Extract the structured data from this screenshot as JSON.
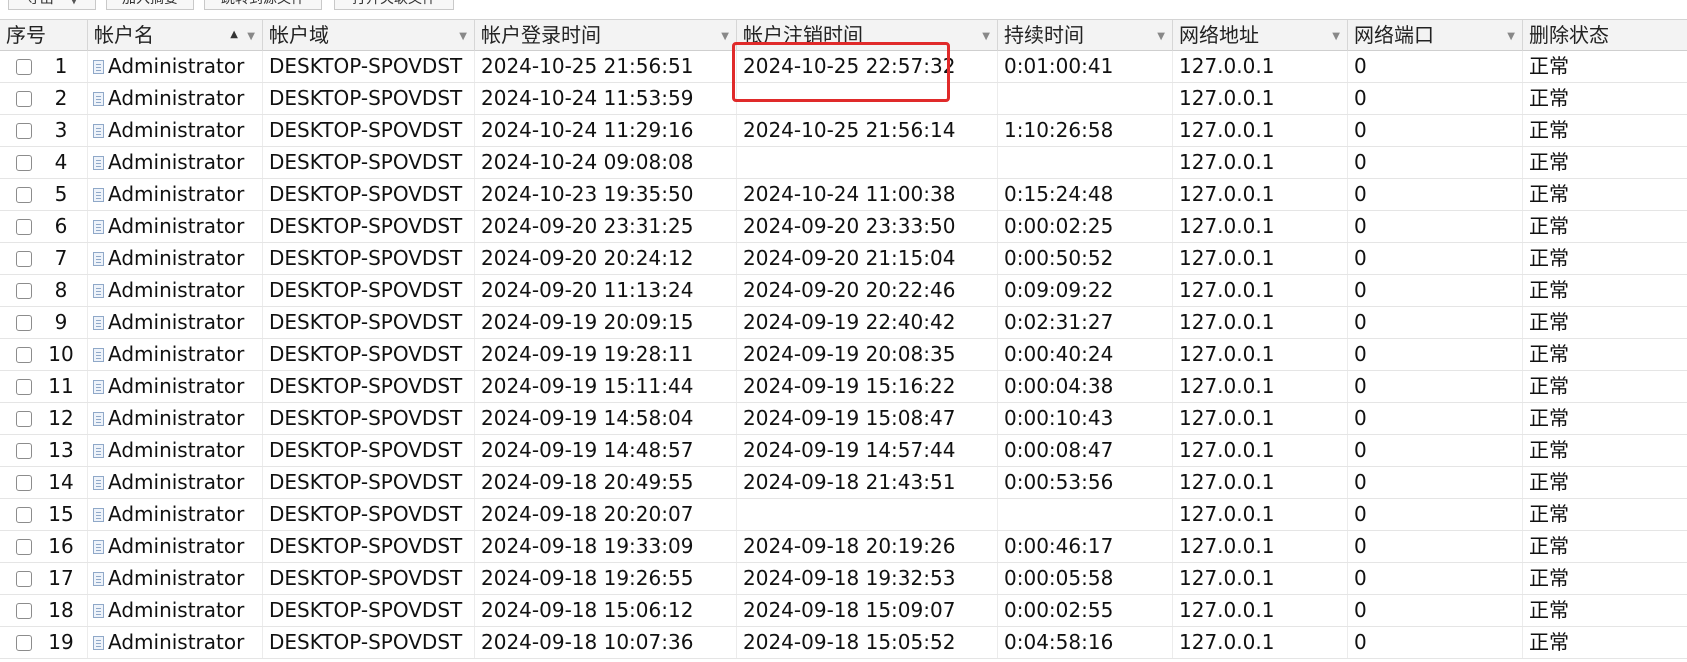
{
  "toolbar": {
    "buttons": [
      "导出",
      "加入摘要",
      "跳转到源文件",
      "打开关联文件"
    ]
  },
  "table": {
    "columns": [
      "序号",
      "帐户名",
      "帐户域",
      "帐户登录时间",
      "帐户注销时间",
      "持续时间",
      "网络地址",
      "网络端口",
      "删除状态"
    ],
    "rows": [
      {
        "seq": "1",
        "user": "Administrator",
        "domain": "DESKTOP-SPOVDST",
        "login": "2024-10-25 21:56:51",
        "logout": "2024-10-25 22:57:32",
        "duration": "0:01:00:41",
        "addr": "127.0.0.1",
        "port": "0",
        "status": "正常"
      },
      {
        "seq": "2",
        "user": "Administrator",
        "domain": "DESKTOP-SPOVDST",
        "login": "2024-10-24 11:53:59",
        "logout": "",
        "duration": "",
        "addr": "127.0.0.1",
        "port": "0",
        "status": "正常"
      },
      {
        "seq": "3",
        "user": "Administrator",
        "domain": "DESKTOP-SPOVDST",
        "login": "2024-10-24 11:29:16",
        "logout": "2024-10-25 21:56:14",
        "duration": "1:10:26:58",
        "addr": "127.0.0.1",
        "port": "0",
        "status": "正常"
      },
      {
        "seq": "4",
        "user": "Administrator",
        "domain": "DESKTOP-SPOVDST",
        "login": "2024-10-24 09:08:08",
        "logout": "",
        "duration": "",
        "addr": "127.0.0.1",
        "port": "0",
        "status": "正常"
      },
      {
        "seq": "5",
        "user": "Administrator",
        "domain": "DESKTOP-SPOVDST",
        "login": "2024-10-23 19:35:50",
        "logout": "2024-10-24 11:00:38",
        "duration": "0:15:24:48",
        "addr": "127.0.0.1",
        "port": "0",
        "status": "正常"
      },
      {
        "seq": "6",
        "user": "Administrator",
        "domain": "DESKTOP-SPOVDST",
        "login": "2024-09-20 23:31:25",
        "logout": "2024-09-20 23:33:50",
        "duration": "0:00:02:25",
        "addr": "127.0.0.1",
        "port": "0",
        "status": "正常"
      },
      {
        "seq": "7",
        "user": "Administrator",
        "domain": "DESKTOP-SPOVDST",
        "login": "2024-09-20 20:24:12",
        "logout": "2024-09-20 21:15:04",
        "duration": "0:00:50:52",
        "addr": "127.0.0.1",
        "port": "0",
        "status": "正常"
      },
      {
        "seq": "8",
        "user": "Administrator",
        "domain": "DESKTOP-SPOVDST",
        "login": "2024-09-20 11:13:24",
        "logout": "2024-09-20 20:22:46",
        "duration": "0:09:09:22",
        "addr": "127.0.0.1",
        "port": "0",
        "status": "正常"
      },
      {
        "seq": "9",
        "user": "Administrator",
        "domain": "DESKTOP-SPOVDST",
        "login": "2024-09-19 20:09:15",
        "logout": "2024-09-19 22:40:42",
        "duration": "0:02:31:27",
        "addr": "127.0.0.1",
        "port": "0",
        "status": "正常"
      },
      {
        "seq": "10",
        "user": "Administrator",
        "domain": "DESKTOP-SPOVDST",
        "login": "2024-09-19 19:28:11",
        "logout": "2024-09-19 20:08:35",
        "duration": "0:00:40:24",
        "addr": "127.0.0.1",
        "port": "0",
        "status": "正常"
      },
      {
        "seq": "11",
        "user": "Administrator",
        "domain": "DESKTOP-SPOVDST",
        "login": "2024-09-19 15:11:44",
        "logout": "2024-09-19 15:16:22",
        "duration": "0:00:04:38",
        "addr": "127.0.0.1",
        "port": "0",
        "status": "正常"
      },
      {
        "seq": "12",
        "user": "Administrator",
        "domain": "DESKTOP-SPOVDST",
        "login": "2024-09-19 14:58:04",
        "logout": "2024-09-19 15:08:47",
        "duration": "0:00:10:43",
        "addr": "127.0.0.1",
        "port": "0",
        "status": "正常"
      },
      {
        "seq": "13",
        "user": "Administrator",
        "domain": "DESKTOP-SPOVDST",
        "login": "2024-09-19 14:48:57",
        "logout": "2024-09-19 14:57:44",
        "duration": "0:00:08:47",
        "addr": "127.0.0.1",
        "port": "0",
        "status": "正常"
      },
      {
        "seq": "14",
        "user": "Administrator",
        "domain": "DESKTOP-SPOVDST",
        "login": "2024-09-18 20:49:55",
        "logout": "2024-09-18 21:43:51",
        "duration": "0:00:53:56",
        "addr": "127.0.0.1",
        "port": "0",
        "status": "正常"
      },
      {
        "seq": "15",
        "user": "Administrator",
        "domain": "DESKTOP-SPOVDST",
        "login": "2024-09-18 20:20:07",
        "logout": "",
        "duration": "",
        "addr": "127.0.0.1",
        "port": "0",
        "status": "正常"
      },
      {
        "seq": "16",
        "user": "Administrator",
        "domain": "DESKTOP-SPOVDST",
        "login": "2024-09-18 19:33:09",
        "logout": "2024-09-18 20:19:26",
        "duration": "0:00:46:17",
        "addr": "127.0.0.1",
        "port": "0",
        "status": "正常"
      },
      {
        "seq": "17",
        "user": "Administrator",
        "domain": "DESKTOP-SPOVDST",
        "login": "2024-09-18 19:26:55",
        "logout": "2024-09-18 19:32:53",
        "duration": "0:00:05:58",
        "addr": "127.0.0.1",
        "port": "0",
        "status": "正常"
      },
      {
        "seq": "18",
        "user": "Administrator",
        "domain": "DESKTOP-SPOVDST",
        "login": "2024-09-18 15:06:12",
        "logout": "2024-09-18 15:09:07",
        "duration": "0:00:02:55",
        "addr": "127.0.0.1",
        "port": "0",
        "status": "正常"
      },
      {
        "seq": "19",
        "user": "Administrator",
        "domain": "DESKTOP-SPOVDST",
        "login": "2024-09-18 10:07:36",
        "logout": "2024-09-18 15:05:52",
        "duration": "0:04:58:16",
        "addr": "127.0.0.1",
        "port": "0",
        "status": "正常"
      }
    ]
  },
  "annotation": {
    "color": "#e02a2a"
  }
}
